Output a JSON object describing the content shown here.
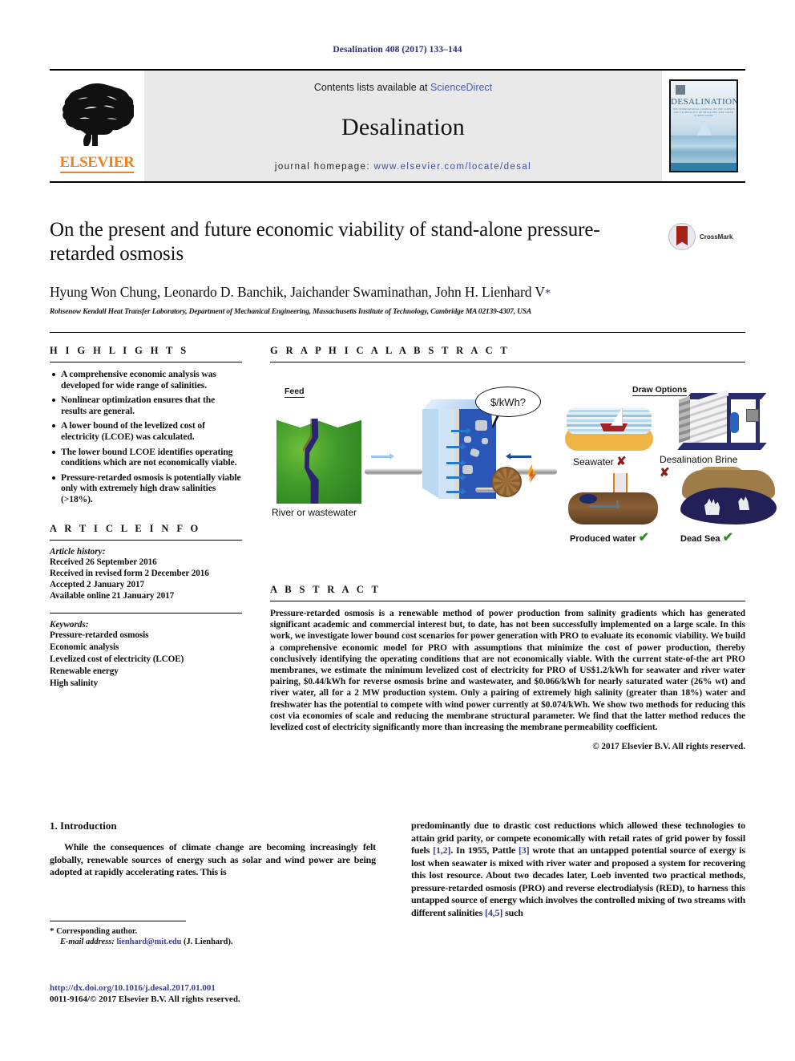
{
  "running_head": "Desalination 408 (2017) 133–144",
  "masthead": {
    "contents_prefix": "Contents lists available at ",
    "contents_link": "ScienceDirect",
    "journal_name": "Desalination",
    "homepage_prefix": "journal homepage: ",
    "homepage_url": "www.elsevier.com/locate/desal",
    "publisher_logo_text": "ELSEVIER",
    "cover_title": "DESALINATION",
    "cover_subtitle": "THE INTERNATIONAL JOURNAL ON THE SCIENCE AND TECHNOLOGY OF DESALTING AND WATER PURIFICATION"
  },
  "article": {
    "title": "On the present and future economic viability of stand-alone pressure-retarded osmosis",
    "authors": "Hyung Won Chung, Leonardo D. Banchik, Jaichander Swaminathan, John H. Lienhard V",
    "corresponding_marker": "*",
    "affiliation": "Rohsenow Kendall Heat Transfer Laboratory, Department of Mechanical Engineering, Massachusetts Institute of Technology, Cambridge MA 02139-4307, USA",
    "crossmark_label": "CrossMark"
  },
  "highlights": {
    "heading": "H I G H L I G H T S",
    "items": [
      "A comprehensive economic analysis was developed for wide range of salinities.",
      "Nonlinear optimization ensures that the results are general.",
      "A lower bound of the levelized cost of electricity (LCOE) was calculated.",
      "The lower bound LCOE identifies operating conditions which are not economically viable.",
      "Pressure-retarded osmosis is potentially viable only with extremely high draw salinities (>18%)."
    ]
  },
  "article_info": {
    "heading": "A R T I C L E    I N F O",
    "history_label": "Article history:",
    "history": [
      "Received 26 September 2016",
      "Received in revised form 2 December 2016",
      "Accepted 2 January 2017",
      "Available online 21 January 2017"
    ],
    "keywords_label": "Keywords:",
    "keywords": [
      "Pressure-retarded osmosis",
      "Economic analysis",
      "Levelized cost of electricity (LCOE)",
      "Renewable energy",
      "High salinity"
    ]
  },
  "graphical_abstract": {
    "heading": "G R A P H I C A L    A B S T R A C T",
    "feed_label": "Feed",
    "feed_caption": "River or wastewater",
    "cost_bubble": "$/kWh?",
    "draw_label": "Draw Options",
    "options": [
      {
        "name": "Seawater",
        "verdict": "x"
      },
      {
        "name": "Desalination Brine",
        "verdict": "x"
      },
      {
        "name": "Produced water",
        "verdict": "check"
      },
      {
        "name": "Dead Sea",
        "verdict": "check"
      }
    ],
    "x_symbol": "✘",
    "check_symbol": "✔"
  },
  "abstract": {
    "heading": "A B S T R A C T",
    "text": "Pressure-retarded osmosis is a renewable method of power production from salinity gradients which has generated significant academic and commercial interest but, to date, has not been successfully implemented on a large scale. In this work, we investigate lower bound cost scenarios for power generation with PRO to evaluate its economic viability. We build a comprehensive economic model for PRO with assumptions that minimize the cost of power production, thereby conclusively identifying the operating conditions that are not economically viable. With the current state-of-the art PRO membranes, we estimate the minimum levelized cost of electricity for PRO of US$1.2/kWh for seawater and river water pairing, $0.44/kWh for reverse osmosis brine and wastewater, and $0.066/kWh for nearly saturated water (26% wt) and river water, all for a 2 MW production system. Only a pairing of extremely high salinity (greater than 18%) water and freshwater has the potential to compete with wind power currently at $0.074/kWh. We show two methods for reducing this cost via economies of scale and reducing the membrane structural parameter. We find that the latter method reduces the levelized cost of electricity significantly more than increasing the membrane permeability coefficient.",
    "copyright": "© 2017 Elsevier B.V. All rights reserved."
  },
  "body": {
    "section_heading": "1. Introduction",
    "left_paragraph_lead": "While the consequences of climate change are becoming increasingly felt globally, renewable sources of energy such as solar and wind power are being adopted at rapidly accelerating rates. This is",
    "right_paragraph_part1": "predominantly due to drastic cost reductions which allowed these technologies to attain grid parity, or compete economically with retail rates of grid power by fossil fuels ",
    "ref_1_2": "[1,2]",
    "right_paragraph_part2": ". In 1955, Pattle ",
    "ref_3": "[3]",
    "right_paragraph_part3": " wrote that an untapped potential source of exergy is lost when seawater is mixed with river water and proposed a system for recovering this lost resource. About two decades later, Loeb invented two practical methods, pressure-retarded osmosis (PRO) and reverse electrodialysis (RED), to harness this untapped source of energy which involves the controlled mixing of two streams with different salinities ",
    "ref_4_5": "[4,5]",
    "right_paragraph_part4": " such"
  },
  "footnote": {
    "star": "*",
    "corresponding": "Corresponding author.",
    "email_label": "E-mail address:",
    "email": "lienhard@mit.edu",
    "email_owner": "(J. Lienhard)."
  },
  "footer": {
    "doi": "http://dx.doi.org/10.1016/j.desal.2017.01.001",
    "issn_line": "0011-9164/© 2017 Elsevier B.V. All rights reserved."
  },
  "colors": {
    "link_blue": "#3b3f8f",
    "sciencedirect_blue": "#4a5aa8",
    "elsevier_orange": "#F08020",
    "check_green": "#2e8b22",
    "x_red": "#8c1b18"
  }
}
